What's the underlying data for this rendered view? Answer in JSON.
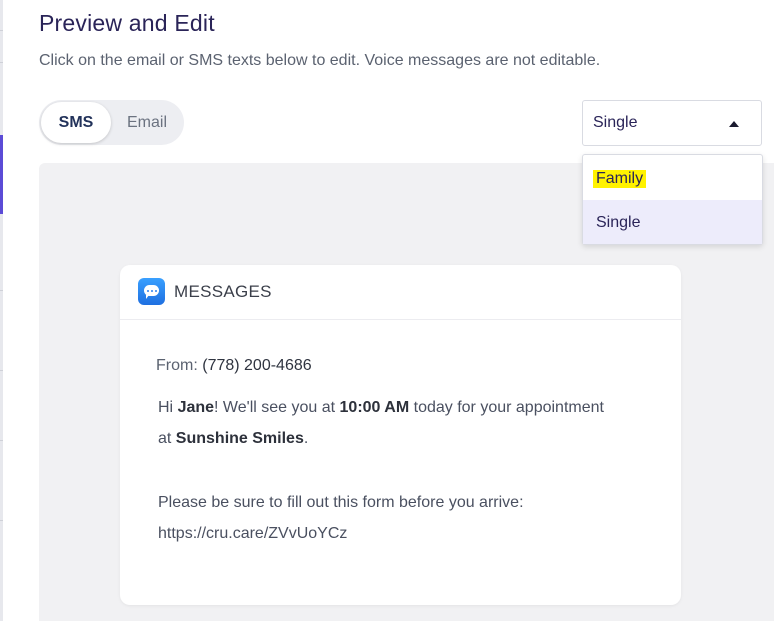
{
  "page": {
    "title": "Preview and Edit",
    "subtitle": "Click on the email or SMS texts below to edit. Voice messages are not editable."
  },
  "channel_toggle": {
    "options": [
      "SMS",
      "Email"
    ],
    "selected": "SMS"
  },
  "audience_select": {
    "value": "Single",
    "options": [
      "Family",
      "Single"
    ],
    "highlighted_option": "Family",
    "hover_option": "Single",
    "expanded": true
  },
  "message_card": {
    "app_icon": "chat-bubble-icon",
    "header": "MESSAGES",
    "from_label": "From:",
    "from_number": "(778) 200-4686",
    "line1": {
      "p1": "Hi ",
      "name": "Jane",
      "p2": "! We'll see you at ",
      "time": "10:00 AM",
      "p3": " today for your appointment"
    },
    "line2": {
      "p1": "at ",
      "clinic": "Sunshine Smiles",
      "p2": "."
    },
    "line3": "Please be sure to fill out this form before you arrive:",
    "line4": "https://cru.care/ZVvUoYCz"
  },
  "colors": {
    "title": "#2a2458",
    "accent": "#5b4bd6",
    "highlight": "#fff200",
    "preview_bg": "#f1f1f3",
    "app_icon": "#2b7fef"
  }
}
